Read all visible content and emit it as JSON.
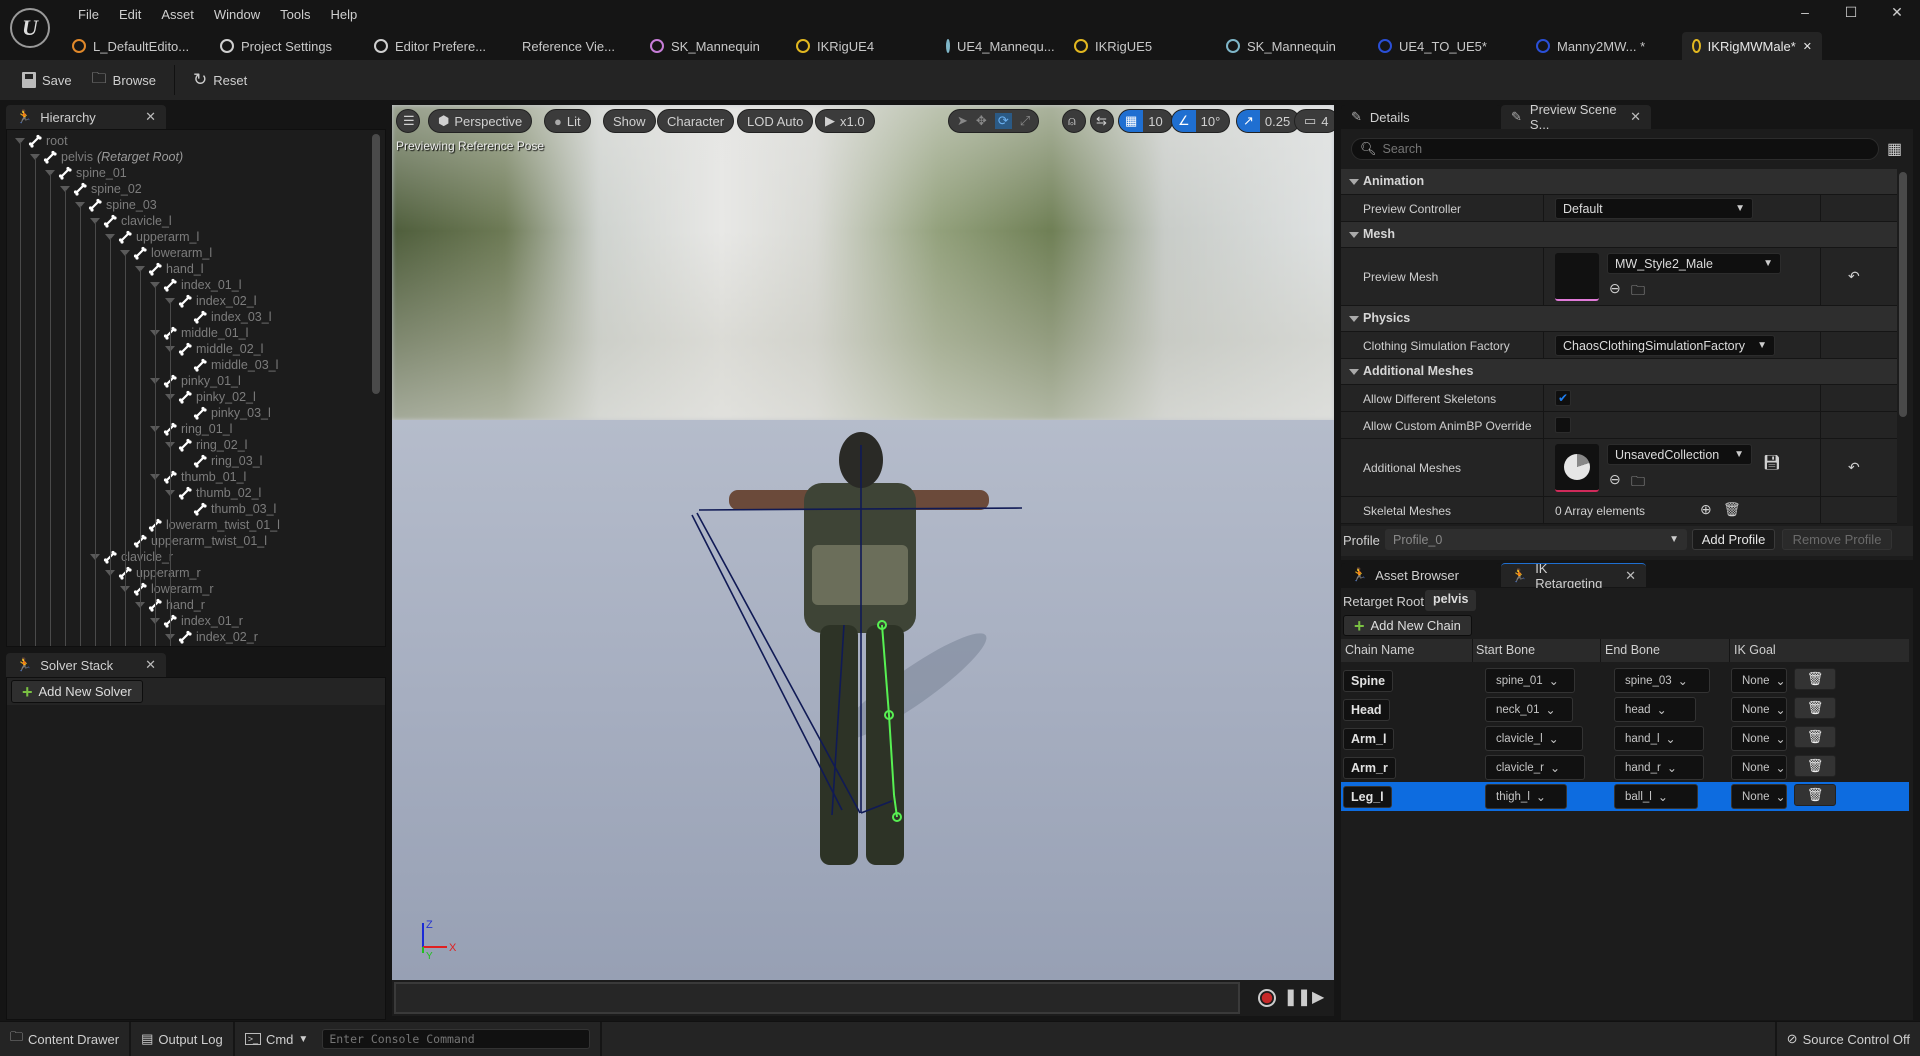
{
  "menu": [
    "File",
    "Edit",
    "Asset",
    "Window",
    "Tools",
    "Help"
  ],
  "window_controls": {
    "minimize": "–",
    "maximize": "☐",
    "close": "✕"
  },
  "doc_tabs": [
    {
      "label": "L_DefaultEdito...",
      "icon": "level-icon",
      "color": "#e0882a"
    },
    {
      "label": "Project Settings",
      "icon": "gear-icon",
      "color": "#cfcfcf"
    },
    {
      "label": "Editor Prefere...",
      "icon": "sliders-icon",
      "color": "#cfcfcf"
    },
    {
      "label": "Reference Vie...",
      "icon": "",
      "color": ""
    },
    {
      "label": "SK_Mannequin",
      "icon": "skeleton-asset-icon",
      "color": "#c77dd8"
    },
    {
      "label": "IKRigUE4",
      "icon": "ikrig-icon",
      "color": "#e1b720"
    },
    {
      "label": "UE4_Mannequ...",
      "icon": "skeleton-figure-icon",
      "color": "#7fb6c8"
    },
    {
      "label": "IKRigUE5",
      "icon": "ikrig-icon",
      "color": "#e1b720"
    },
    {
      "label": "SK_Mannequin",
      "icon": "skeleton-figure-icon",
      "color": "#7fb6c8"
    },
    {
      "label": "UE4_TO_UE5*",
      "icon": "retargeter-icon",
      "color": "#2a4fd6"
    },
    {
      "label": "Manny2MW...  *",
      "icon": "retargeter-icon",
      "color": "#2a4fd6"
    },
    {
      "label": "IKRigMWMale*",
      "icon": "ikrig-icon",
      "color": "#e1b720",
      "active": true
    }
  ],
  "toolbar": {
    "save": "Save",
    "browse": "Browse",
    "reset": "Reset"
  },
  "hierarchy": {
    "title": "Hierarchy",
    "retarget_root_suffix": "(Retarget Root)",
    "bones": [
      {
        "name": "root",
        "depth": 0,
        "expand": true
      },
      {
        "name": "pelvis",
        "depth": 1,
        "expand": true,
        "retarget_root": true
      },
      {
        "name": "spine_01",
        "depth": 2,
        "expand": true
      },
      {
        "name": "spine_02",
        "depth": 3,
        "expand": true
      },
      {
        "name": "spine_03",
        "depth": 4,
        "expand": true
      },
      {
        "name": "clavicle_l",
        "depth": 5,
        "expand": true
      },
      {
        "name": "upperarm_l",
        "depth": 6,
        "expand": true
      },
      {
        "name": "lowerarm_l",
        "depth": 7,
        "expand": true
      },
      {
        "name": "hand_l",
        "depth": 8,
        "expand": true
      },
      {
        "name": "index_01_l",
        "depth": 9,
        "expand": true
      },
      {
        "name": "index_02_l",
        "depth": 10,
        "expand": true
      },
      {
        "name": "index_03_l",
        "depth": 11,
        "expand": false
      },
      {
        "name": "middle_01_l",
        "depth": 9,
        "expand": true
      },
      {
        "name": "middle_02_l",
        "depth": 10,
        "expand": true
      },
      {
        "name": "middle_03_l",
        "depth": 11,
        "expand": false
      },
      {
        "name": "pinky_01_l",
        "depth": 9,
        "expand": true
      },
      {
        "name": "pinky_02_l",
        "depth": 10,
        "expand": true
      },
      {
        "name": "pinky_03_l",
        "depth": 11,
        "expand": false
      },
      {
        "name": "ring_01_l",
        "depth": 9,
        "expand": true
      },
      {
        "name": "ring_02_l",
        "depth": 10,
        "expand": true
      },
      {
        "name": "ring_03_l",
        "depth": 11,
        "expand": false
      },
      {
        "name": "thumb_01_l",
        "depth": 9,
        "expand": true
      },
      {
        "name": "thumb_02_l",
        "depth": 10,
        "expand": true
      },
      {
        "name": "thumb_03_l",
        "depth": 11,
        "expand": false
      },
      {
        "name": "lowerarm_twist_01_l",
        "depth": 8,
        "expand": false
      },
      {
        "name": "upperarm_twist_01_l",
        "depth": 7,
        "expand": false
      },
      {
        "name": "clavicle_r",
        "depth": 5,
        "expand": true
      },
      {
        "name": "upperarm_r",
        "depth": 6,
        "expand": true
      },
      {
        "name": "lowerarm_r",
        "depth": 7,
        "expand": true
      },
      {
        "name": "hand_r",
        "depth": 8,
        "expand": true
      },
      {
        "name": "index_01_r",
        "depth": 9,
        "expand": true
      },
      {
        "name": "index_02_r",
        "depth": 10,
        "expand": true
      }
    ]
  },
  "solver_stack": {
    "title": "Solver Stack",
    "add_button": "Add New Solver"
  },
  "viewport": {
    "menu_icon": "hamburger-icon",
    "perspective": "Perspective",
    "lit": "Lit",
    "show": "Show",
    "character": "Character",
    "lod": "LOD Auto",
    "play_speed": "x1.0",
    "grid_snap": "10",
    "rotation_snap": "10°",
    "scale_snap": "0.25",
    "camera_speed": "4",
    "status_label": "Previewing Reference Pose",
    "axis_labels": {
      "z": "Z",
      "x": "X",
      "y": "Y"
    }
  },
  "details": {
    "tabs": [
      {
        "label": "Details"
      },
      {
        "label": "Preview Scene S..."
      }
    ],
    "search_placeholder": "Search",
    "categories": {
      "animation": "Animation",
      "mesh": "Mesh",
      "physics": "Physics",
      "additional_meshes": "Additional Meshes"
    },
    "props": {
      "preview_controller": {
        "label": "Preview Controller",
        "value": "Default"
      },
      "preview_mesh": {
        "label": "Preview Mesh",
        "value": "MW_Style2_Male"
      },
      "clothing_factory": {
        "label": "Clothing Simulation Factory",
        "value": "ChaosClothingSimulationFactory"
      },
      "allow_diff_skeletons": {
        "label": "Allow Different Skeletons",
        "checked": true
      },
      "allow_custom_animbp": {
        "label": "Allow Custom AnimBP Override",
        "checked": false
      },
      "additional_meshes": {
        "label": "Additional Meshes",
        "value": "UnsavedCollection"
      },
      "skeletal_meshes": {
        "label": "Skeletal Meshes",
        "value": "0 Array elements"
      }
    },
    "profile": {
      "label": "Profile",
      "value": "Profile_0",
      "add": "Add Profile",
      "remove": "Remove Profile"
    }
  },
  "ik_retargeting": {
    "tabs": [
      {
        "label": "Asset Browser"
      },
      {
        "label": "IK Retargeting"
      }
    ],
    "retarget_root_label": "Retarget Root:",
    "retarget_root_value": "pelvis",
    "add_chain": "Add New Chain",
    "columns": [
      "Chain Name",
      "Start Bone",
      "End Bone",
      "IK Goal"
    ],
    "chains": [
      {
        "name": "Spine",
        "start": "spine_01",
        "end": "spine_03",
        "goal": "None"
      },
      {
        "name": "Head",
        "start": "neck_01",
        "end": "head",
        "goal": "None"
      },
      {
        "name": "Arm_l",
        "start": "clavicle_l",
        "end": "hand_l",
        "goal": "None"
      },
      {
        "name": "Arm_r",
        "start": "clavicle_r",
        "end": "hand_r",
        "goal": "None"
      },
      {
        "name": "Leg_l",
        "start": "thigh_l",
        "end": "ball_l",
        "goal": "None",
        "selected": true
      }
    ]
  },
  "statusbar": {
    "content_drawer": "Content Drawer",
    "output_log": "Output Log",
    "cmd": "Cmd",
    "console_placeholder": "Enter Console Command",
    "source_control": "Source Control Off"
  }
}
